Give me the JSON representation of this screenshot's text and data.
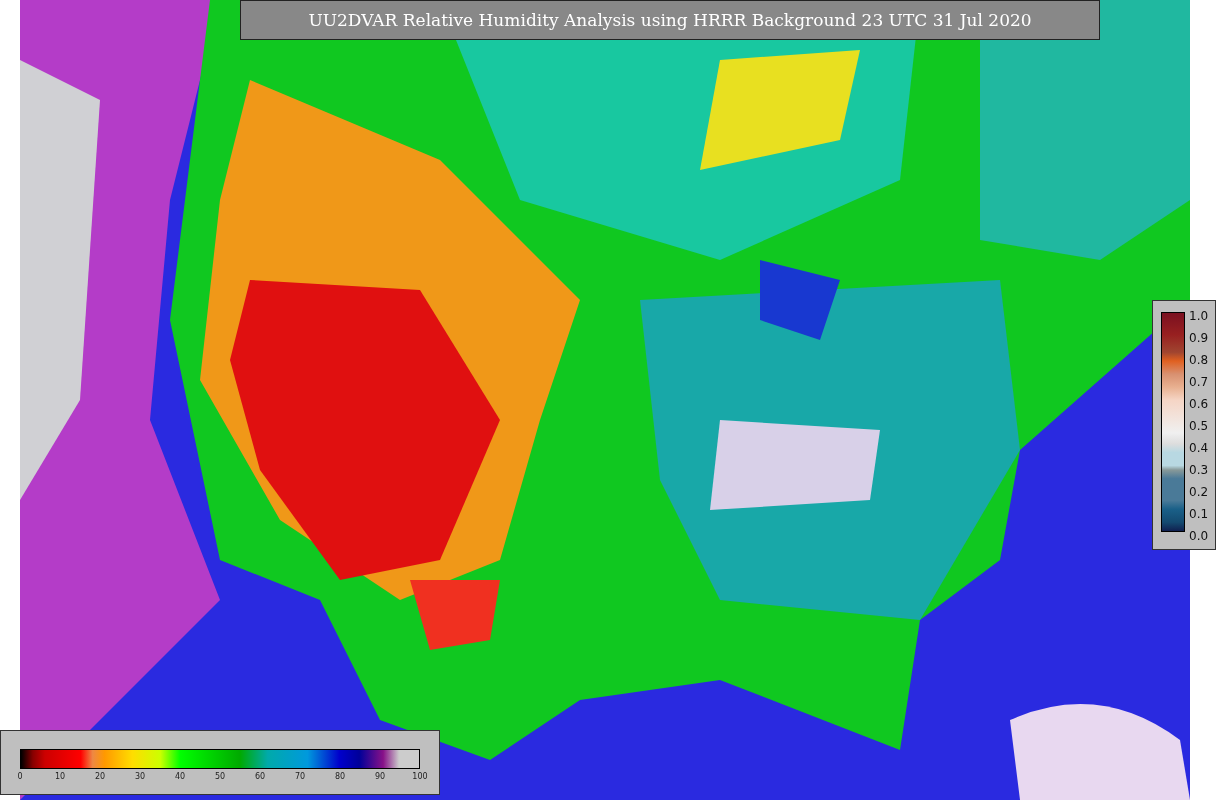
{
  "title": "UU2DVAR Relative Humidity Analysis using HRRR Background 23 UTC 31 Jul 2020",
  "humidity_scale": {
    "ticks": [
      "0",
      "10",
      "20",
      "30",
      "40",
      "50",
      "60",
      "70",
      "80",
      "90",
      "100"
    ]
  },
  "fraction_scale": {
    "ticks": [
      "1.0",
      "0.9",
      "0.8",
      "0.7",
      "0.6",
      "0.5",
      "0.4",
      "0.3",
      "0.2",
      "0.1",
      "0.0"
    ]
  }
}
